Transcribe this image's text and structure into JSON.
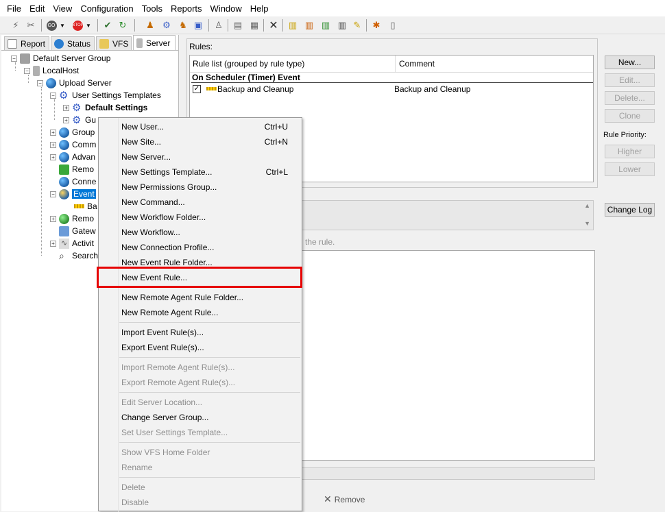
{
  "menubar": [
    "File",
    "Edit",
    "View",
    "Configuration",
    "Tools",
    "Reports",
    "Window",
    "Help"
  ],
  "tabs": [
    {
      "label": "Report",
      "icon": "report-icon"
    },
    {
      "label": "Status",
      "icon": "status-icon"
    },
    {
      "label": "VFS",
      "icon": "vfs-icon"
    },
    {
      "label": "Server",
      "icon": "server-icon"
    }
  ],
  "tree": [
    {
      "label": "Default Server Group",
      "icon": "server-group-icon"
    },
    {
      "label": "LocalHost",
      "icon": "host-icon"
    },
    {
      "label": "Upload Server",
      "icon": "globe-icon"
    },
    {
      "label": "User Settings Templates",
      "icon": "gear-icon"
    },
    {
      "label": "Default Settings",
      "icon": "gear-icon"
    },
    {
      "label": "Gu",
      "icon": "gear-icon"
    },
    {
      "label": "Group",
      "icon": "globe-icon"
    },
    {
      "label": "Comm",
      "icon": "globe-icon"
    },
    {
      "label": "Advan",
      "icon": "globe-icon"
    },
    {
      "label": "Remo",
      "icon": "remote-icon"
    },
    {
      "label": "Conne",
      "icon": "globe-icon"
    },
    {
      "label": "Event",
      "icon": "globe-icon"
    },
    {
      "label": "Ba",
      "icon": "ruler-icon"
    },
    {
      "label": "Remo",
      "icon": "globe-icon"
    },
    {
      "label": "Gatew",
      "icon": "gateway-icon"
    },
    {
      "label": "Activit",
      "icon": "activity-icon"
    },
    {
      "label": "Search",
      "icon": "search-icon"
    }
  ],
  "rules": {
    "label": "Rules:",
    "col1": "Rule list (grouped by rule type)",
    "col2": "Comment",
    "group": "On Scheduler (Timer) Event",
    "row": {
      "name": "Backup and Cleanup",
      "comment": "Backup and Cleanup",
      "checked": true
    }
  },
  "buttons": {
    "new": "New...",
    "edit": "Edit...",
    "delete": "Delete...",
    "clone": "Clone",
    "priority_label": "Rule Priority:",
    "higher": "Higher",
    "lower": "Lower",
    "changelog": "Change Log",
    "remove": "Remove"
  },
  "hint_text": "the rule.",
  "context_menu": [
    {
      "label": "New User...",
      "shortcut": "Ctrl+U",
      "disabled": false
    },
    {
      "label": "New Site...",
      "shortcut": "Ctrl+N",
      "disabled": false
    },
    {
      "label": "New Server...",
      "shortcut": "",
      "disabled": false
    },
    {
      "label": "New Settings Template...",
      "shortcut": "Ctrl+L",
      "disabled": false
    },
    {
      "label": "New Permissions Group...",
      "shortcut": "",
      "disabled": false
    },
    {
      "label": "New Command...",
      "shortcut": "",
      "disabled": false
    },
    {
      "label": "New Workflow Folder...",
      "shortcut": "",
      "disabled": false
    },
    {
      "label": "New Workflow...",
      "shortcut": "",
      "disabled": false
    },
    {
      "label": "New Connection Profile...",
      "shortcut": "",
      "disabled": false
    },
    {
      "label": "New Event Rule Folder...",
      "shortcut": "",
      "disabled": false
    },
    {
      "label": "New Event Rule...",
      "shortcut": "",
      "disabled": false
    },
    {
      "label": "New Remote Agent Rule Folder...",
      "shortcut": "",
      "disabled": false
    },
    {
      "label": "New Remote Agent Rule...",
      "shortcut": "",
      "disabled": false
    },
    {
      "label": "Import Event Rule(s)...",
      "shortcut": "",
      "disabled": false
    },
    {
      "label": "Export Event Rule(s)...",
      "shortcut": "",
      "disabled": false
    },
    {
      "label": "Import Remote Agent Rule(s)...",
      "shortcut": "",
      "disabled": true
    },
    {
      "label": "Export Remote Agent Rule(s)...",
      "shortcut": "",
      "disabled": true
    },
    {
      "label": "Edit Server Location...",
      "shortcut": "",
      "disabled": true
    },
    {
      "label": "Change Server Group...",
      "shortcut": "",
      "disabled": false
    },
    {
      "label": "Set User Settings Template...",
      "shortcut": "",
      "disabled": true
    },
    {
      "label": "Show VFS Home Folder",
      "shortcut": "",
      "disabled": true
    },
    {
      "label": "Rename",
      "shortcut": "",
      "disabled": true
    },
    {
      "label": "Delete",
      "shortcut": "",
      "disabled": true
    },
    {
      "label": "Disable",
      "shortcut": "",
      "disabled": true
    }
  ],
  "colors": {
    "highlight": "#e60000",
    "selection": "#0078d7"
  }
}
